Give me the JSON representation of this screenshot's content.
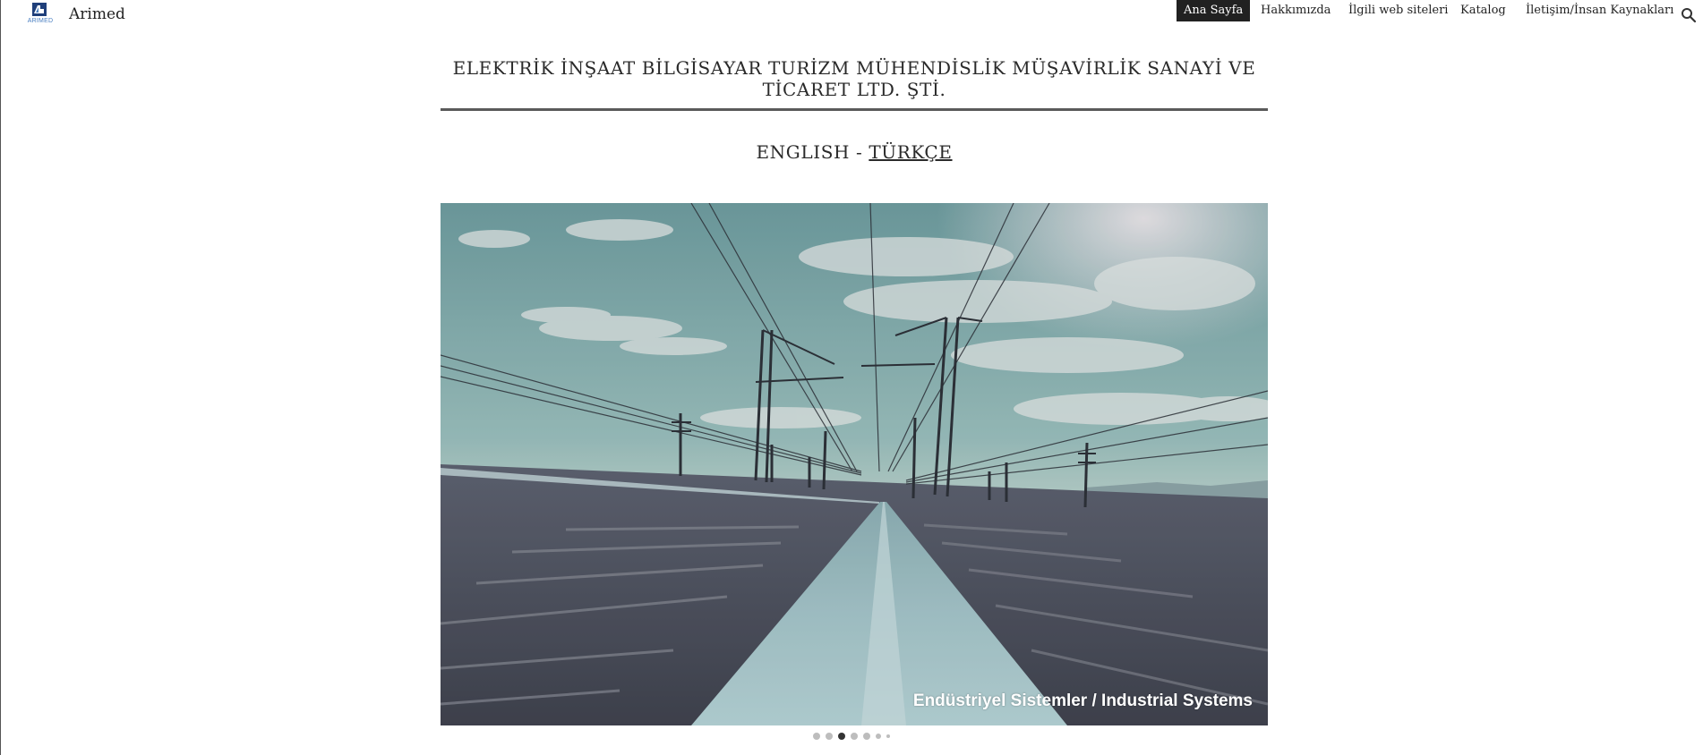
{
  "header": {
    "logo_text": "ARIMED",
    "site_title": "Arimed",
    "nav": [
      {
        "label": "Ana Sayfa",
        "active": true
      },
      {
        "label": "Hakkımızda",
        "active": false
      },
      {
        "label": "İlgili web siteleri",
        "active": false
      },
      {
        "label": "Katalog",
        "active": false
      },
      {
        "label": "İletişim/İnsan Kaynakları",
        "active": false
      }
    ],
    "search_icon": "search-icon"
  },
  "main": {
    "company_name": "ELEKTRİK İNŞAAT BİLGİSAYAR TURİZM MÜHENDİSLİK MÜŞAVİRLİK SANAYİ VE TİCARET LTD. ŞTİ.",
    "lang_english": "ENGLISH",
    "lang_separator": " - ",
    "lang_turkce": "TÜRKÇE ",
    "carousel": {
      "caption": "Endüstriyel Sistemler / Industrial Systems",
      "slide_count": 7,
      "active_index": 2
    }
  },
  "colors": {
    "nav_active_bg": "#212121",
    "divider": "#5a5a5a",
    "logo_blue": "#4a7fc1"
  }
}
